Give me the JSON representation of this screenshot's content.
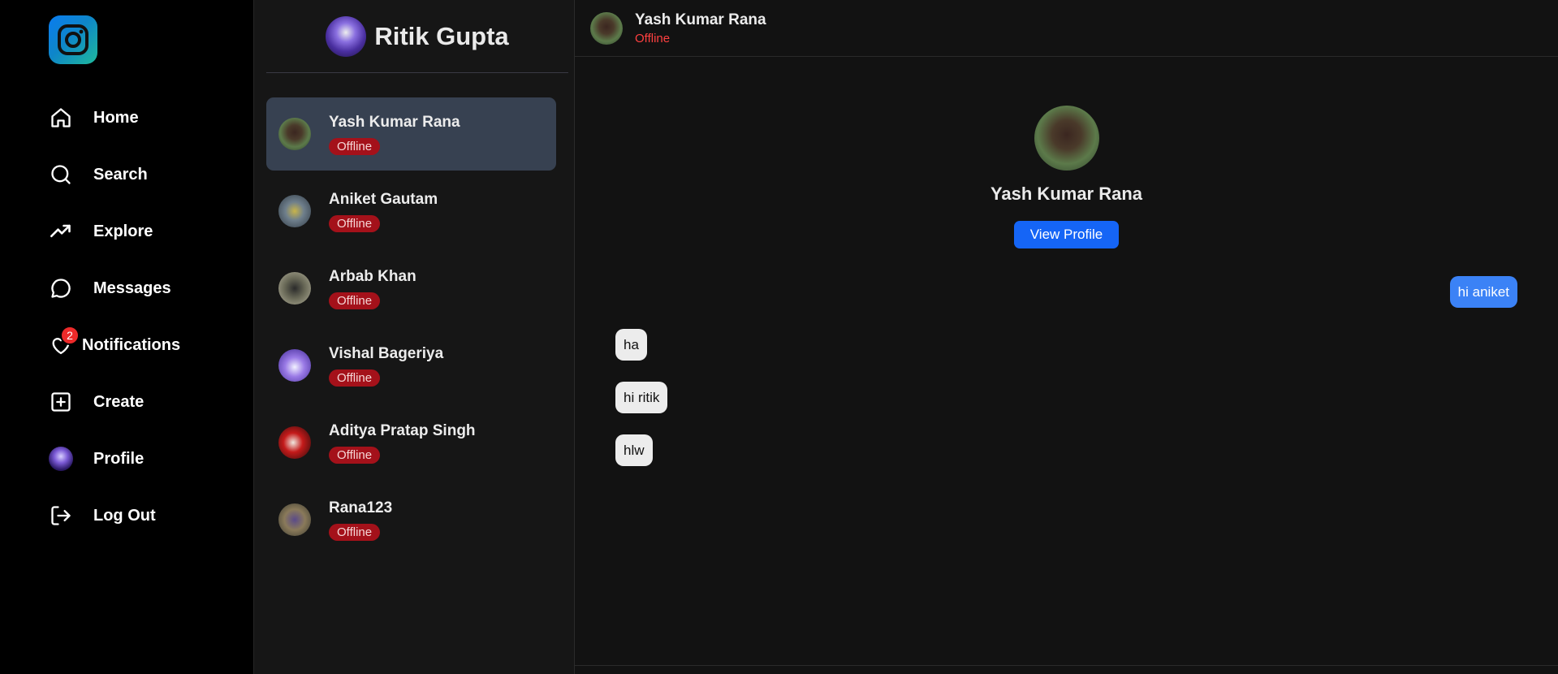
{
  "nav": {
    "items": [
      {
        "label": "Home",
        "icon": "home-icon"
      },
      {
        "label": "Search",
        "icon": "search-icon"
      },
      {
        "label": "Explore",
        "icon": "trending-icon"
      },
      {
        "label": "Messages",
        "icon": "chat-bubble-icon"
      },
      {
        "label": "Notifications",
        "icon": "heart-icon",
        "badge": "2"
      },
      {
        "label": "Create",
        "icon": "plus-square-icon"
      },
      {
        "label": "Profile",
        "icon": "avatar"
      },
      {
        "label": "Log Out",
        "icon": "logout-icon"
      }
    ]
  },
  "conversations": {
    "current_user": "Ritik Gupta",
    "items": [
      {
        "name": "Yash Kumar Rana",
        "status": "Offline",
        "active": true
      },
      {
        "name": "Aniket Gautam",
        "status": "Offline"
      },
      {
        "name": "Arbab Khan",
        "status": "Offline"
      },
      {
        "name": "Vishal Bageriya",
        "status": "Offline"
      },
      {
        "name": "Aditya Pratap Singh",
        "status": "Offline"
      },
      {
        "name": "Rana123",
        "status": "Offline"
      }
    ]
  },
  "chat": {
    "header": {
      "name": "Yash Kumar Rana",
      "status": "Offline"
    },
    "profile": {
      "name": "Yash Kumar Rana",
      "button": "View Profile"
    },
    "messages": [
      {
        "text": "hi aniket",
        "direction": "out"
      },
      {
        "text": "ha",
        "direction": "in"
      },
      {
        "text": "hi ritik",
        "direction": "in"
      },
      {
        "text": "hlw",
        "direction": "in"
      }
    ]
  },
  "colors": {
    "active_conversation": "#374151",
    "offline_pill": "#a4111a",
    "outgoing_bubble": "#3b82f6",
    "incoming_bubble": "#ececec",
    "primary_button": "#1565f6",
    "badge": "#ed2a2a"
  }
}
